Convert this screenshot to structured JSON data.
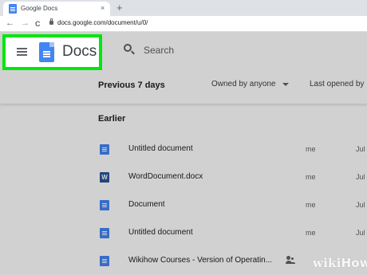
{
  "browser": {
    "tab_title": "Google Docs",
    "tab_close": "×",
    "new_tab": "+",
    "back": "←",
    "forward": "→",
    "reload": "C",
    "url": "docs.google.com/document/u/0/"
  },
  "header": {
    "app_name": "Docs",
    "search_placeholder": "Search",
    "highlight_color": "#00e60f"
  },
  "list_header": {
    "section": "Previous 7 days",
    "owned_by": "Owned by anyone",
    "last_opened": "Last opened by"
  },
  "earlier_label": "Earlier",
  "documents": [
    {
      "name": "Untitled document",
      "owner": "me",
      "date": "Jul",
      "icon": "doc-icon"
    },
    {
      "name": "WordDocument.docx",
      "owner": "me",
      "date": "Jul",
      "icon": "word-icon",
      "icon_text": "W"
    },
    {
      "name": "Document",
      "owner": "me",
      "date": "Jul",
      "icon": "doc-icon"
    },
    {
      "name": "Untitled document",
      "owner": "me",
      "date": "Jul",
      "icon": "doc-icon"
    },
    {
      "name": "Wikihow Courses - Version of Operatin...",
      "owner": "",
      "date": "",
      "icon": "doc-icon",
      "shared": true
    }
  ],
  "watermark": {
    "wiki": "wiki",
    "how": "How"
  }
}
